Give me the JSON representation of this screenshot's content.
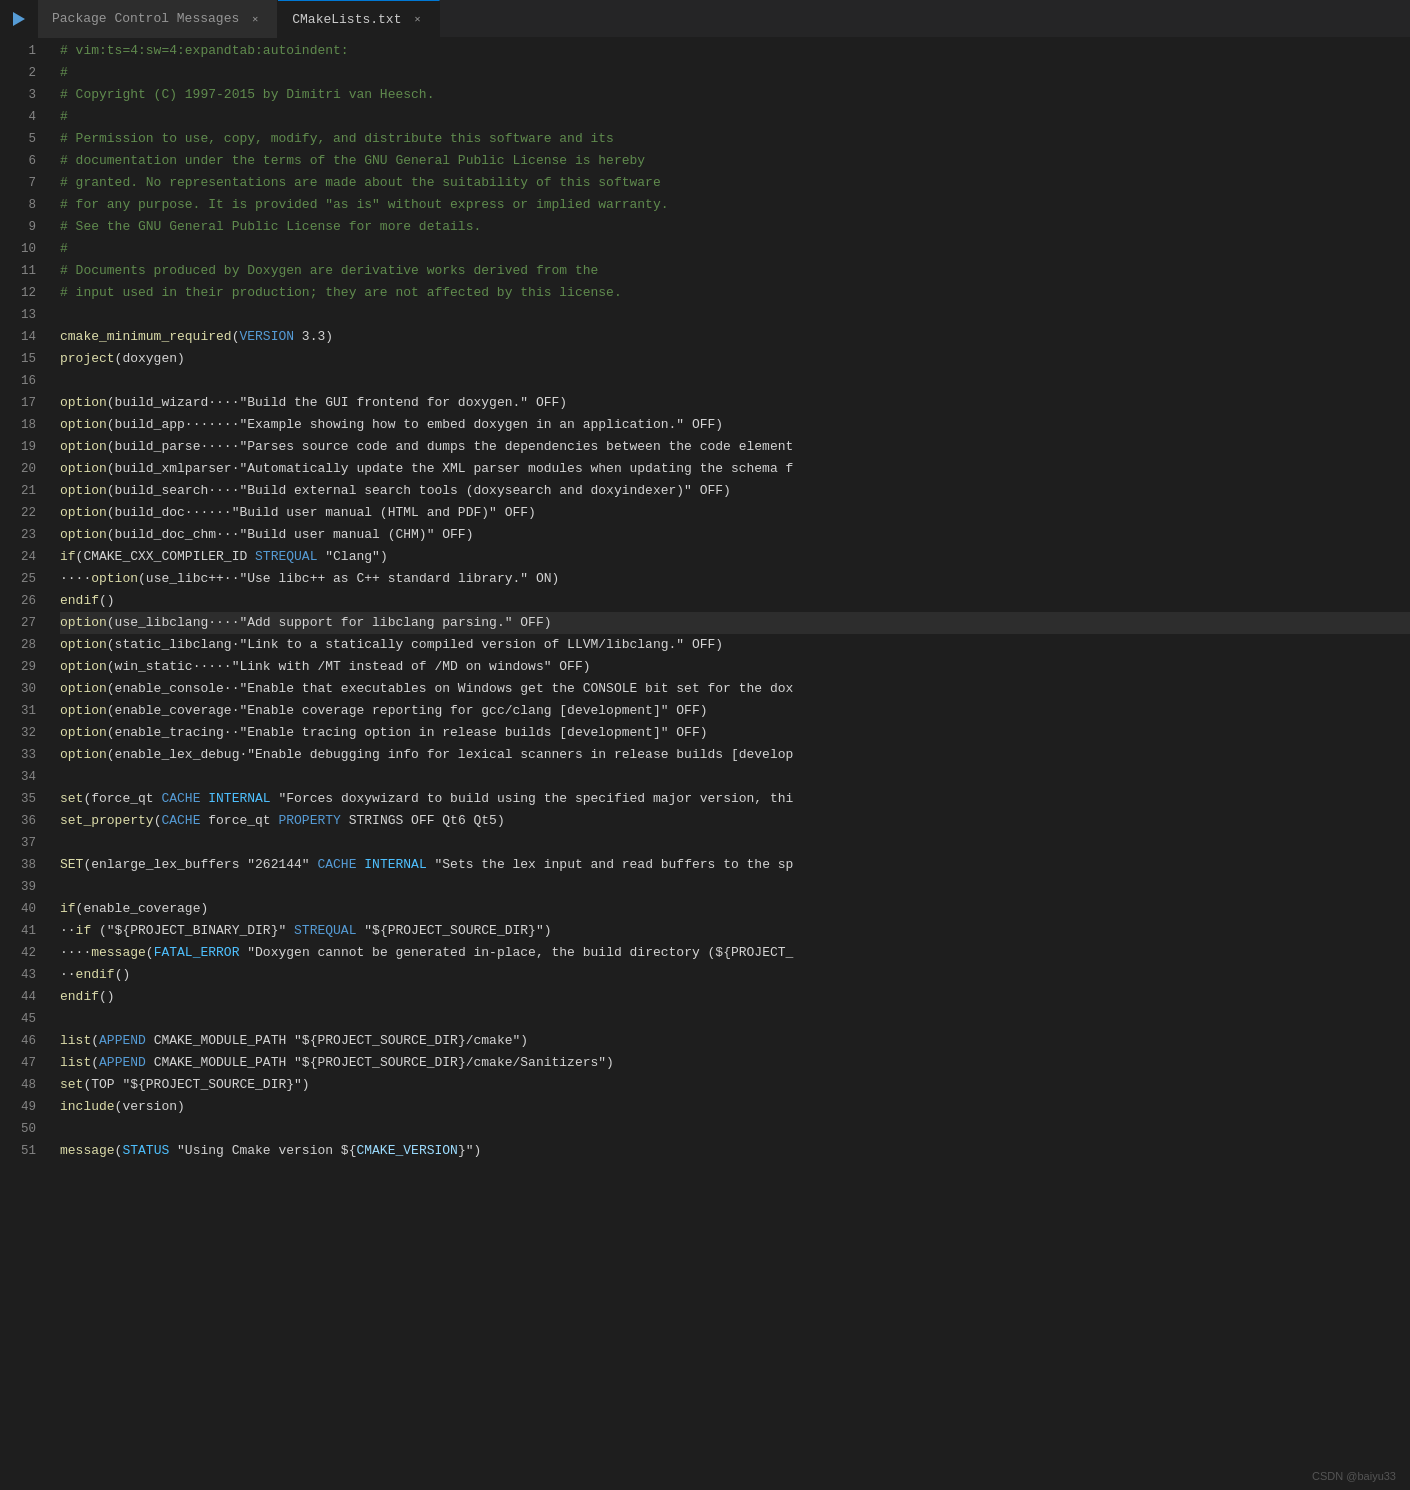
{
  "tabs": [
    {
      "label": "Package Control Messages",
      "active": false,
      "id": "pkg-ctrl"
    },
    {
      "label": "CMakeLists.txt",
      "active": true,
      "id": "cmake"
    }
  ],
  "lines": [
    {
      "num": 1,
      "tokens": [
        {
          "cls": "cm",
          "t": "# vim:ts=4:sw=4:expandtab:autoindent:"
        }
      ]
    },
    {
      "num": 2,
      "tokens": [
        {
          "cls": "cm",
          "t": "#"
        }
      ]
    },
    {
      "num": 3,
      "tokens": [
        {
          "cls": "cm",
          "t": "# Copyright (C) 1997-2015 by Dimitri van Heesch."
        }
      ]
    },
    {
      "num": 4,
      "tokens": [
        {
          "cls": "cm",
          "t": "#"
        }
      ]
    },
    {
      "num": 5,
      "tokens": [
        {
          "cls": "cm",
          "t": "# Permission to use, copy, modify, and distribute this software and its"
        }
      ]
    },
    {
      "num": 6,
      "tokens": [
        {
          "cls": "cm",
          "t": "# documentation under the terms of the GNU General Public License is hereby"
        }
      ]
    },
    {
      "num": 7,
      "tokens": [
        {
          "cls": "cm",
          "t": "# granted. No representations are made about the suitability of this software"
        }
      ]
    },
    {
      "num": 8,
      "tokens": [
        {
          "cls": "cm",
          "t": "# for any purpose. It is provided \"as is\" without express or implied warranty."
        }
      ]
    },
    {
      "num": 9,
      "tokens": [
        {
          "cls": "cm",
          "t": "# See the GNU General Public License for more details."
        }
      ]
    },
    {
      "num": 10,
      "tokens": [
        {
          "cls": "cm",
          "t": "#"
        }
      ]
    },
    {
      "num": 11,
      "tokens": [
        {
          "cls": "cm",
          "t": "# Documents produced by Doxygen are derivative works derived from the"
        }
      ]
    },
    {
      "num": 12,
      "tokens": [
        {
          "cls": "cm",
          "t": "# input used in their production; they are not affected by this license."
        }
      ]
    },
    {
      "num": 13,
      "tokens": []
    },
    {
      "num": 14,
      "tokens": [
        {
          "cls": "fn",
          "t": "cmake_minimum_required"
        },
        {
          "cls": "plain",
          "t": "("
        },
        {
          "cls": "kw",
          "t": "VERSION"
        },
        {
          "cls": "plain",
          "t": " 3.3)"
        }
      ]
    },
    {
      "num": 15,
      "tokens": [
        {
          "cls": "fn",
          "t": "project"
        },
        {
          "cls": "plain",
          "t": "(doxygen)"
        }
      ]
    },
    {
      "num": 16,
      "tokens": []
    },
    {
      "num": 17,
      "tokens": [
        {
          "cls": "fn",
          "t": "option"
        },
        {
          "cls": "plain",
          "t": "(build_wizard····\"Build the GUI frontend for doxygen.\" OFF)"
        }
      ]
    },
    {
      "num": 18,
      "tokens": [
        {
          "cls": "fn",
          "t": "option"
        },
        {
          "cls": "plain",
          "t": "(build_app·······\"Example showing how to embed doxygen in an application.\" OFF)"
        }
      ]
    },
    {
      "num": 19,
      "tokens": [
        {
          "cls": "fn",
          "t": "option"
        },
        {
          "cls": "plain",
          "t": "(build_parse·····\"Parses source code and dumps the dependencies between the code element"
        }
      ]
    },
    {
      "num": 20,
      "tokens": [
        {
          "cls": "fn",
          "t": "option"
        },
        {
          "cls": "plain",
          "t": "(build_xmlparser·\"Automatically update the XML parser modules when updating the schema f"
        }
      ]
    },
    {
      "num": 21,
      "tokens": [
        {
          "cls": "fn",
          "t": "option"
        },
        {
          "cls": "plain",
          "t": "(build_search····\"Build external search tools (doxysearch and doxyindexer)\" OFF)"
        }
      ]
    },
    {
      "num": 22,
      "tokens": [
        {
          "cls": "fn",
          "t": "option"
        },
        {
          "cls": "plain",
          "t": "(build_doc······\"Build user manual (HTML and PDF)\" OFF)"
        }
      ]
    },
    {
      "num": 23,
      "tokens": [
        {
          "cls": "fn",
          "t": "option"
        },
        {
          "cls": "plain",
          "t": "(build_doc_chm···\"Build user manual (CHM)\" OFF)"
        }
      ]
    },
    {
      "num": 24,
      "tokens": [
        {
          "cls": "fn",
          "t": "if"
        },
        {
          "cls": "plain",
          "t": "(CMAKE_CXX_COMPILER_ID "
        },
        {
          "cls": "kw",
          "t": "STREQUAL"
        },
        {
          "cls": "plain",
          "t": " \"Clang\")"
        }
      ]
    },
    {
      "num": 25,
      "tokens": [
        {
          "cls": "plain",
          "t": "····"
        },
        {
          "cls": "fn",
          "t": "option"
        },
        {
          "cls": "plain",
          "t": "(use_libc++··\"Use libc++ as C++ standard library.\" ON)"
        }
      ]
    },
    {
      "num": 26,
      "tokens": [
        {
          "cls": "fn",
          "t": "endif"
        },
        {
          "cls": "plain",
          "t": "()"
        }
      ]
    },
    {
      "num": 27,
      "tokens": [
        {
          "cls": "fn",
          "t": "option"
        },
        {
          "cls": "plain",
          "t": "(use_libclan"
        },
        {
          "cls": "plain",
          "t": "g····\"Add support for libclang parsing.\" OFF)"
        }
      ],
      "cursor": true
    },
    {
      "num": 28,
      "tokens": [
        {
          "cls": "fn",
          "t": "option"
        },
        {
          "cls": "plain",
          "t": "(static_libclang·\"Link to a statically compiled version of LLVM/libclang.\" OFF)"
        }
      ]
    },
    {
      "num": 29,
      "tokens": [
        {
          "cls": "fn",
          "t": "option"
        },
        {
          "cls": "plain",
          "t": "(win_static·····\"Link with /MT instead of /MD on windows\" OFF)"
        }
      ]
    },
    {
      "num": 30,
      "tokens": [
        {
          "cls": "fn",
          "t": "option"
        },
        {
          "cls": "plain",
          "t": "(enable_console··\"Enable that executables on Windows get the CONSOLE bit set for the dox"
        }
      ]
    },
    {
      "num": 31,
      "tokens": [
        {
          "cls": "fn",
          "t": "option"
        },
        {
          "cls": "plain",
          "t": "(enable_coverage·\"Enable coverage reporting for gcc/clang [development]\" OFF)"
        }
      ]
    },
    {
      "num": 32,
      "tokens": [
        {
          "cls": "fn",
          "t": "option"
        },
        {
          "cls": "plain",
          "t": "(enable_tracing··\"Enable tracing option in release builds [development]\" OFF)"
        }
      ]
    },
    {
      "num": 33,
      "tokens": [
        {
          "cls": "fn",
          "t": "option"
        },
        {
          "cls": "plain",
          "t": "(enable_lex_debug·\"Enable debugging info for lexical scanners in release builds [develop"
        }
      ]
    },
    {
      "num": 34,
      "tokens": []
    },
    {
      "num": 35,
      "tokens": [
        {
          "cls": "fn",
          "t": "set"
        },
        {
          "cls": "plain",
          "t": "(force_qt "
        },
        {
          "cls": "kw",
          "t": "CACHE"
        },
        {
          "cls": "plain",
          "t": " "
        },
        {
          "cls": "macro",
          "t": "INTERNAL"
        },
        {
          "cls": "plain",
          "t": " \"Forces doxywizard to build using the specified major version, thi"
        }
      ]
    },
    {
      "num": 36,
      "tokens": [
        {
          "cls": "fn",
          "t": "set_property"
        },
        {
          "cls": "plain",
          "t": "("
        },
        {
          "cls": "kw",
          "t": "CACHE"
        },
        {
          "cls": "plain",
          "t": " force_qt "
        },
        {
          "cls": "kw",
          "t": "PROPERTY"
        },
        {
          "cls": "plain",
          "t": " STRINGS OFF Qt6 Qt5)"
        }
      ]
    },
    {
      "num": 37,
      "tokens": []
    },
    {
      "num": 38,
      "tokens": [
        {
          "cls": "fn",
          "t": "SET"
        },
        {
          "cls": "plain",
          "t": "(enlarge_lex_buffers \"262144\" "
        },
        {
          "cls": "kw",
          "t": "CACHE"
        },
        {
          "cls": "plain",
          "t": " "
        },
        {
          "cls": "macro",
          "t": "INTERNAL"
        },
        {
          "cls": "plain",
          "t": " \"Sets the lex input and read buffers to the sp"
        }
      ]
    },
    {
      "num": 39,
      "tokens": []
    },
    {
      "num": 40,
      "tokens": [
        {
          "cls": "fn",
          "t": "if"
        },
        {
          "cls": "plain",
          "t": "(enable_coverage)"
        }
      ]
    },
    {
      "num": 41,
      "tokens": [
        {
          "cls": "plain",
          "t": "··"
        },
        {
          "cls": "fn",
          "t": "if"
        },
        {
          "cls": "plain",
          "t": " (\"${PROJECT_BINARY_DIR}\" "
        },
        {
          "cls": "kw",
          "t": "STREQUAL"
        },
        {
          "cls": "plain",
          "t": " \"${PROJECT_SOURCE_DIR}\")"
        }
      ]
    },
    {
      "num": 42,
      "tokens": [
        {
          "cls": "plain",
          "t": "····"
        },
        {
          "cls": "fn",
          "t": "message"
        },
        {
          "cls": "plain",
          "t": "("
        },
        {
          "cls": "macro",
          "t": "FATAL_ERROR"
        },
        {
          "cls": "plain",
          "t": " \"Doxygen cannot be generated in-place, the build directory (${PROJECT_"
        }
      ]
    },
    {
      "num": 43,
      "tokens": [
        {
          "cls": "plain",
          "t": "··"
        },
        {
          "cls": "fn",
          "t": "endif"
        },
        {
          "cls": "plain",
          "t": "()"
        }
      ]
    },
    {
      "num": 44,
      "tokens": [
        {
          "cls": "fn",
          "t": "endif"
        },
        {
          "cls": "plain",
          "t": "()"
        }
      ]
    },
    {
      "num": 45,
      "tokens": []
    },
    {
      "num": 46,
      "tokens": [
        {
          "cls": "fn",
          "t": "list"
        },
        {
          "cls": "plain",
          "t": "("
        },
        {
          "cls": "kw",
          "t": "APPEND"
        },
        {
          "cls": "plain",
          "t": " CMAKE_MODULE_PATH \"${PROJECT_SOURCE_DIR}/cmake\")"
        }
      ]
    },
    {
      "num": 47,
      "tokens": [
        {
          "cls": "fn",
          "t": "list"
        },
        {
          "cls": "plain",
          "t": "("
        },
        {
          "cls": "kw",
          "t": "APPEND"
        },
        {
          "cls": "plain",
          "t": " CMAKE_MODULE_PATH \"${PROJECT_SOURCE_DIR}/cmake/Sanitizers\")"
        }
      ]
    },
    {
      "num": 48,
      "tokens": [
        {
          "cls": "fn",
          "t": "set"
        },
        {
          "cls": "plain",
          "t": "(TOP \"${PROJECT_SOURCE_DIR}\")"
        }
      ]
    },
    {
      "num": 49,
      "tokens": [
        {
          "cls": "fn",
          "t": "include"
        },
        {
          "cls": "plain",
          "t": "(version)"
        }
      ]
    },
    {
      "num": 50,
      "tokens": []
    },
    {
      "num": 51,
      "tokens": [
        {
          "cls": "fn",
          "t": "message"
        },
        {
          "cls": "plain",
          "t": "("
        },
        {
          "cls": "macro",
          "t": "STATUS"
        },
        {
          "cls": "plain",
          "t": " \"Using Cmake version ${"
        },
        {
          "cls": "var",
          "t": "CMAKE_VERSION"
        },
        {
          "cls": "plain",
          "t": "}\")"
        }
      ]
    }
  ],
  "watermark": "CSDN @baiyu33"
}
